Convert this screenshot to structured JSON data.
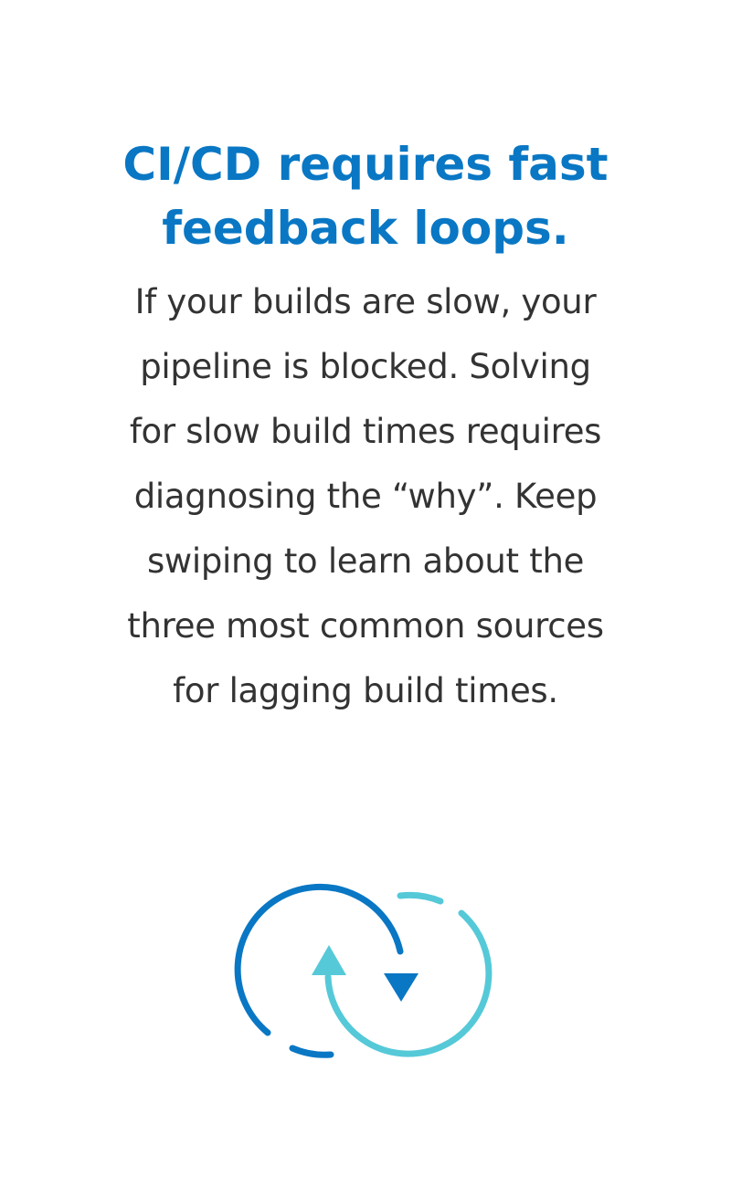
{
  "headline": {
    "lines": [
      "CI/CD requires fast",
      "feedback loops."
    ]
  },
  "body": {
    "lines": [
      "If your builds are slow, your",
      "pipeline is blocked. Solving",
      "for slow build times requires",
      "diagnosing the “why”. Keep",
      "swiping to learn about the",
      "three most common sources",
      "for lagging build times."
    ]
  },
  "icon": {
    "name": "refresh-cycle-icon",
    "colors": {
      "dark_blue": "#0977c4",
      "light_blue": "#55c9d8"
    }
  }
}
